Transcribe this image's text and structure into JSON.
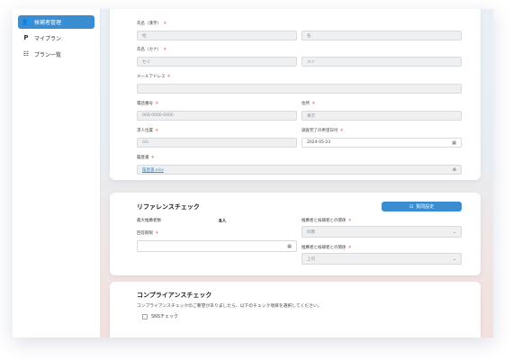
{
  "sidebar": {
    "items": [
      {
        "label": "候補者管理",
        "icon": "people-icon",
        "glyph": "👥",
        "active": true
      },
      {
        "label": "マイプラン",
        "icon": "p-icon",
        "glyph": "P",
        "active": false
      },
      {
        "label": "プラン一覧",
        "icon": "list-icon",
        "glyph": "☷",
        "active": false
      }
    ]
  },
  "personal": {
    "name_kanji_label": "氏名（漢字）",
    "name_kanji_last_placeholder": "姓",
    "name_kanji_first_placeholder": "名",
    "name_kana_label": "氏名（カナ）",
    "name_kana_last_placeholder": "セイ",
    "name_kana_first_placeholder": "メイ",
    "email_label": "メールアドレス",
    "email_value": "",
    "phone_label": "電話番号",
    "phone_placeholder": "000-0000-0000",
    "address_label": "住所",
    "address_placeholder": "東京",
    "position_label": "求人位置",
    "position_placeholder": "GG",
    "deadline_label": "調査完了の希望日付",
    "deadline_value": "2024-05-23",
    "resume_label": "履歴書",
    "resume_value": "履歴書.xlsx",
    "required_mark": "＊"
  },
  "reference": {
    "title": "リファレンスチェック",
    "settings_button": "質問設定",
    "max_refs_label": "最大推薦者数",
    "max_refs_value": "8人",
    "deadline_label": "回答期限",
    "deadline_value": "",
    "relation1_label": "推薦者と候補者との関係",
    "relation1_value": "同僚",
    "relation2_label": "推薦者と候補者との関係",
    "relation2_value": "上司"
  },
  "compliance": {
    "title": "コンプライアンスチェック",
    "description": "コンプライアンスチェックのご要望がありましたら、以下のチェック項目を選択してください。",
    "sns_check_label": "SNSチェック"
  },
  "colors": {
    "accent": "#3a8dd0",
    "required": "#e04545"
  }
}
